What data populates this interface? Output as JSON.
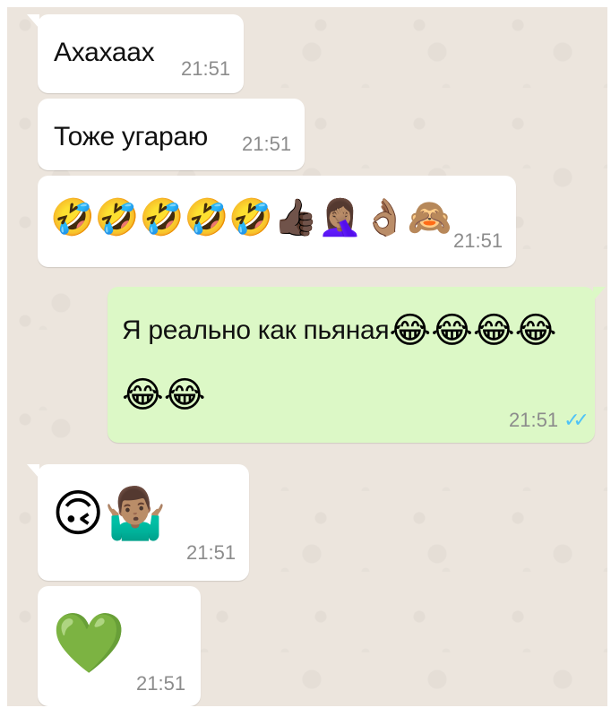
{
  "chat": {
    "messages": [
      {
        "direction": "incoming",
        "text": "Ахахаах",
        "time": "21:51"
      },
      {
        "direction": "incoming",
        "text": "Тоже угараю",
        "time": "21:51"
      },
      {
        "direction": "incoming",
        "emojis": [
          "🤣",
          "🤣",
          "🤣",
          "🤣",
          "🤣",
          "👍🏿",
          "🤦🏽‍♀️",
          "👌🏽",
          "🙈"
        ],
        "time": "21:51"
      },
      {
        "direction": "outgoing",
        "text": "Я реально как пьяная",
        "emojis_inline": [
          "😂",
          "😂",
          "😂",
          "😂"
        ],
        "emojis_line2": [
          "😂",
          "😂"
        ],
        "time": "21:51",
        "status": "read"
      },
      {
        "direction": "incoming",
        "emojis": [
          "🙃",
          "🤷🏽‍♂️"
        ],
        "time": "21:51"
      },
      {
        "direction": "incoming",
        "emojis": [
          "💚"
        ],
        "time": "21:51"
      }
    ],
    "read_receipt_icon": "double-check-icon",
    "colors": {
      "background": "#ece5dd",
      "incoming_bubble": "#ffffff",
      "outgoing_bubble": "#dcf8c6",
      "read_ticks": "#4fc3f7"
    }
  }
}
